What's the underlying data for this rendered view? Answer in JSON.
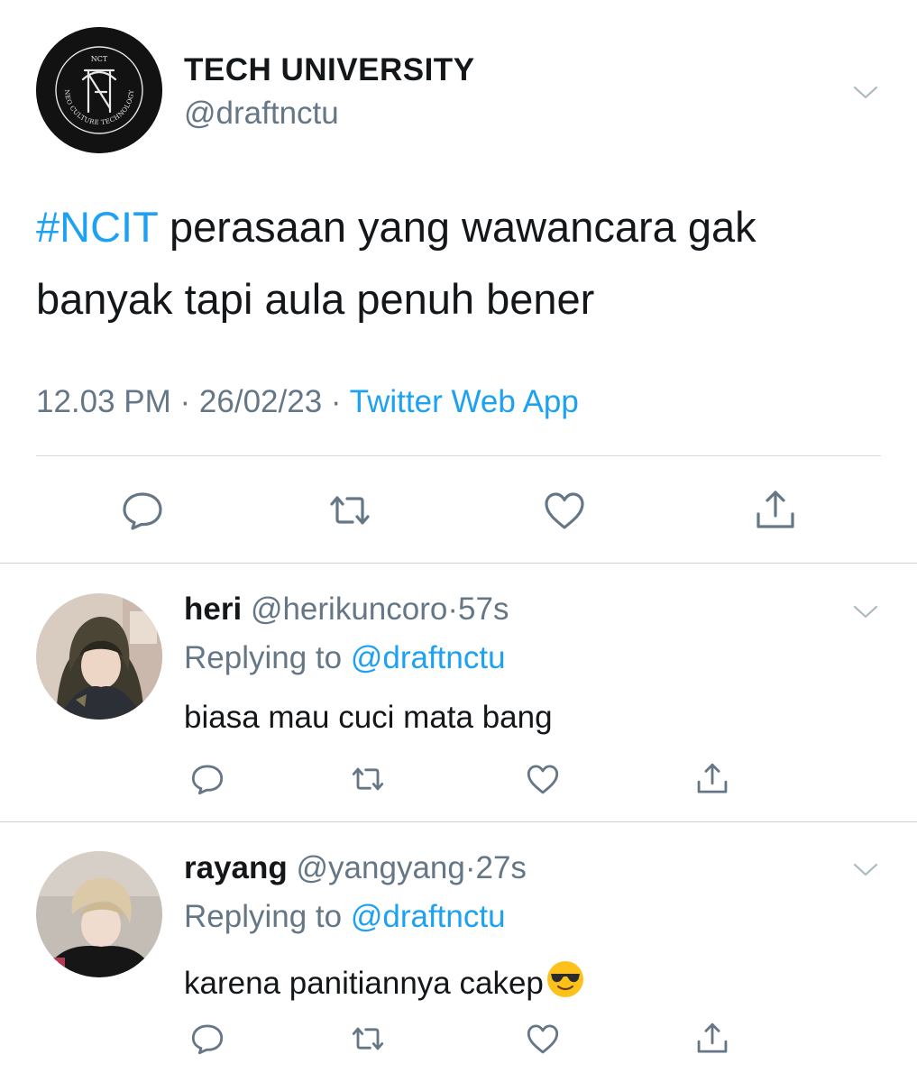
{
  "main_tweet": {
    "name": "TECH UNIVERSITY",
    "handle": "@draftnctu",
    "avatar_text": {
      "top": "NCT",
      "ring": "NEO CULTURE TECHNOLOGY"
    },
    "hashtag": "#NCIT",
    "text": " perasaan yang wawancara gak banyak tapi aula penuh bener",
    "time": "12.03 PM",
    "separator": " · ",
    "date": "26/02/23",
    "source": "Twitter Web App"
  },
  "replies": [
    {
      "name": "heri",
      "handle": "@herikuncoro",
      "separator": "·",
      "age": "57s",
      "replying_label": "Replying to ",
      "replying_handle": "@draftnctu",
      "text": "biasa mau cuci mata bang",
      "emoji": ""
    },
    {
      "name": "rayang",
      "handle": "@yangyang",
      "separator": "·",
      "age": "27s",
      "replying_label": "Replying to ",
      "replying_handle": "@draftnctu",
      "text": "karena panitiannya cakep",
      "emoji": "smiling-face-with-sunglasses-emoji"
    }
  ],
  "icons": {
    "reply": "reply-icon",
    "retweet": "retweet-icon",
    "like": "heart-icon",
    "share": "share-icon",
    "caret": "chevron-down-icon"
  },
  "colors": {
    "link": "#1da1f2",
    "secondary_text": "#657786",
    "text": "#14171a",
    "icon": "#657786"
  }
}
